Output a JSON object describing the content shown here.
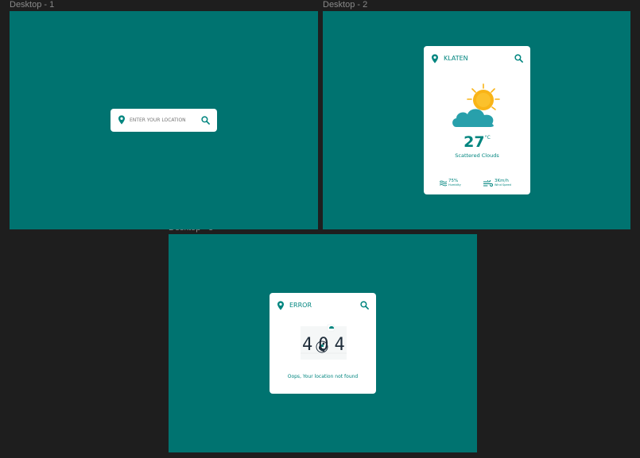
{
  "colors": {
    "canvas": "#1e1e1e",
    "frame": "#007370",
    "text": "#00857f",
    "sun": "#f9b417",
    "cloud": "#28a0ab",
    "card": "#ffffff"
  },
  "frames": [
    {
      "label": "Desktop - 1"
    },
    {
      "label": "Desktop - 2"
    },
    {
      "label": "Desktop - 3"
    }
  ],
  "desktop1": {
    "search": {
      "placeholder": "ENTER YOUR LOCATION",
      "icon": "search-icon",
      "location_icon": "map-pin-icon"
    }
  },
  "desktop2": {
    "location": "KLATEN",
    "temperature": "27",
    "unit": "°C",
    "condition": "Scattered Clouds",
    "weather_icon": "sun-cloud-icon",
    "humidity": {
      "value": "75%",
      "label": "Humidity",
      "icon": "humidity-icon"
    },
    "wind": {
      "value": "3Km/h",
      "label": "Wind Speed",
      "icon": "wind-icon"
    }
  },
  "desktop3": {
    "location": "ERROR",
    "error_code": "404",
    "message": "Oops, Your location not found",
    "illustration": "404-illustration"
  }
}
